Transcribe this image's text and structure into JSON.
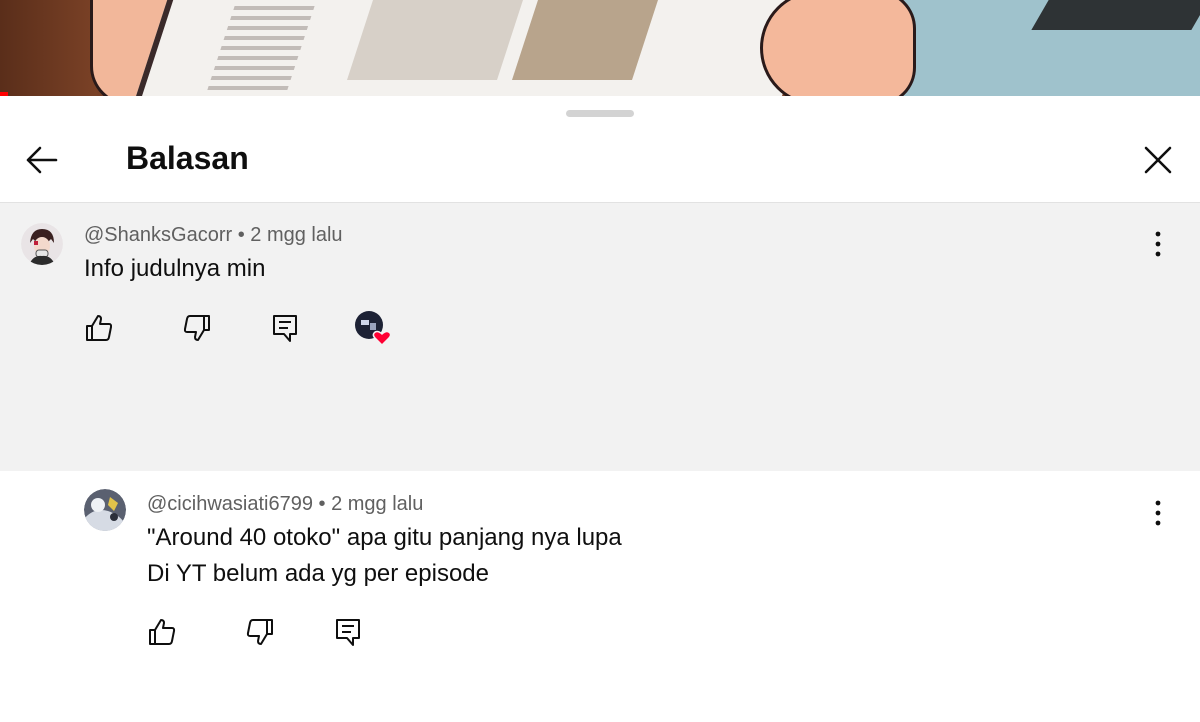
{
  "header": {
    "title": "Balasan"
  },
  "parent_comment": {
    "author": "@ShanksGacorr",
    "separator": " • ",
    "time": "2 mgg lalu",
    "text": "Info judulnya min"
  },
  "reply_comment": {
    "author": "@cicihwasiati6799",
    "separator": " • ",
    "time": "2 mgg lalu",
    "text_line1": "\"Around 40 otoko\" apa gitu panjang nya lupa",
    "text_line2": "Di YT belum ada yg per episode"
  },
  "colors": {
    "heart": "#ff0033",
    "parent_bg": "#f2f2f2",
    "meta_text": "#606060"
  },
  "icons": {
    "back": "arrow-left-icon",
    "close": "close-icon",
    "more": "more-vertical-icon",
    "like": "thumbs-up-icon",
    "dislike": "thumbs-down-icon",
    "reply": "comment-icon",
    "creator_heart": "heart-icon"
  }
}
